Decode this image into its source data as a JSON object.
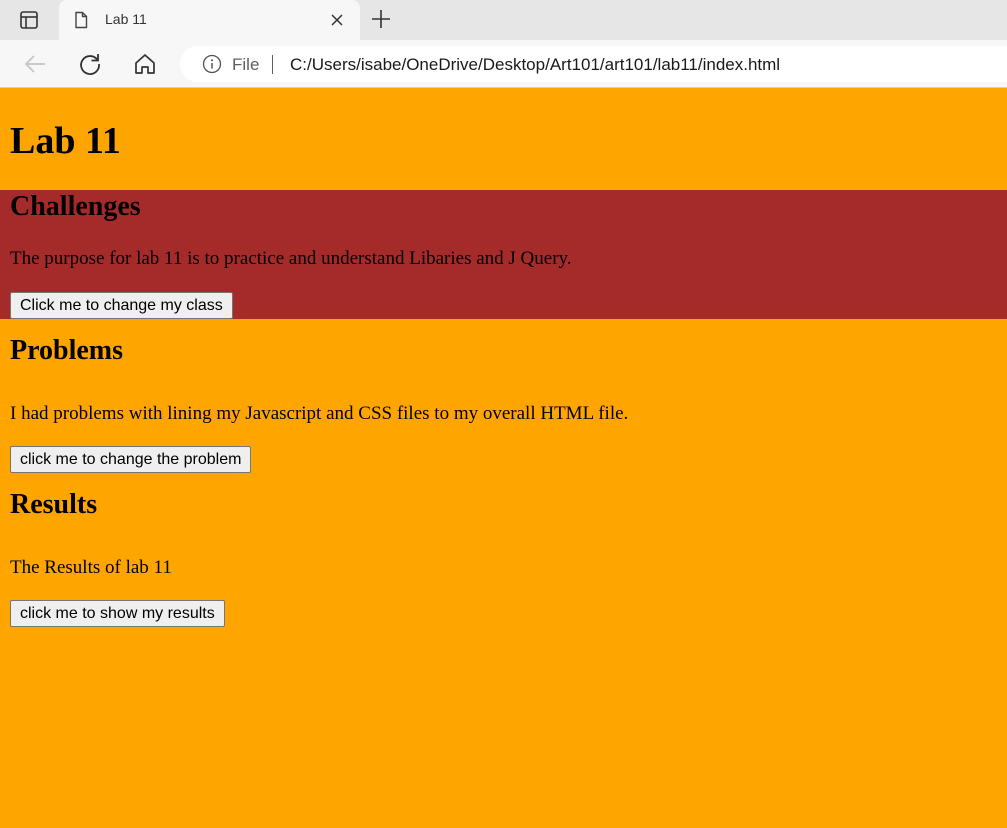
{
  "browser": {
    "tab": {
      "title": "Lab 11"
    },
    "address_bar": {
      "scheme_label": "File",
      "url": "C:/Users/isabe/OneDrive/Desktop/Art101/art101/lab11/index.html"
    },
    "icons": {
      "tab_actions": "tab-actions-icon",
      "favicon": "page-icon",
      "tab_close": "close-icon",
      "new_tab": "plus-icon",
      "back": "back-arrow-icon",
      "refresh": "refresh-icon",
      "home": "home-icon",
      "site_info": "info-icon"
    }
  },
  "page": {
    "title": "Lab 11",
    "background_color": "#ffa500",
    "sections": [
      {
        "heading": "Challenges",
        "text": "The purpose for lab 11 is to practice and understand Libaries and J Query.",
        "button_label": "Click me to change my class",
        "background_color": "#a52a2a"
      },
      {
        "heading": "Problems",
        "text": "I had problems with lining my Javascript and CSS files to my overall HTML file.",
        "button_label": "click me to change the problem"
      },
      {
        "heading": "Results",
        "text": "The Results of lab 11",
        "button_label": "click me to show my results"
      }
    ]
  }
}
